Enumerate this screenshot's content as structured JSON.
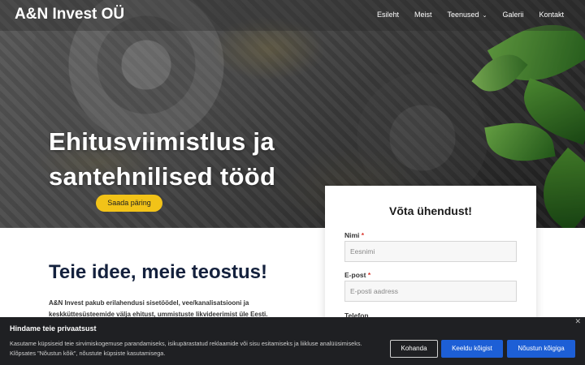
{
  "header": {
    "brand": "A&N Invest OÜ",
    "nav": [
      "Esileht",
      "Meist",
      "Teenused",
      "Galerii",
      "Kontakt"
    ]
  },
  "hero": {
    "title_line1": "Ehitusviimistlus ja",
    "title_line2": "santehnilised tööd",
    "cta": "Saada päring"
  },
  "contact_form": {
    "title": "Võta ühendust!",
    "name_label": "Nimi",
    "name_placeholder": "Eesnimi",
    "email_label": "E-post",
    "email_placeholder": "E-posti aadress",
    "phone_label": "Telefon",
    "required_mark": "*"
  },
  "content": {
    "title": "Teie idee, meie teostus!",
    "text": "A&N Invest pakub erilahendusi sisetöödel, vee/kanalisatsiooni ja keskküttesüsteemide välja ehitust, ummistuste likvideerimist üle Eesti."
  },
  "cookie": {
    "title": "Hindame teie privaatsust",
    "text": "Kasutame küpsiseid teie sirvimiskogemuse parandamiseks, isikupärastatud reklaamide või sisu esitamiseks ja liikluse analüüsimiseks. Klõpsates \"Nõustun kõik\", nõustute küpsiste kasutamisega.",
    "customize": "Kohanda",
    "reject": "Keeldu kõigist",
    "accept": "Nõustun kõigiga",
    "close_icon": "close-icon"
  },
  "colors": {
    "cta_yellow": "#f2c318",
    "button_blue": "#1d5fd6",
    "banner_bg": "#1f2023",
    "heading_navy": "#14213d"
  }
}
